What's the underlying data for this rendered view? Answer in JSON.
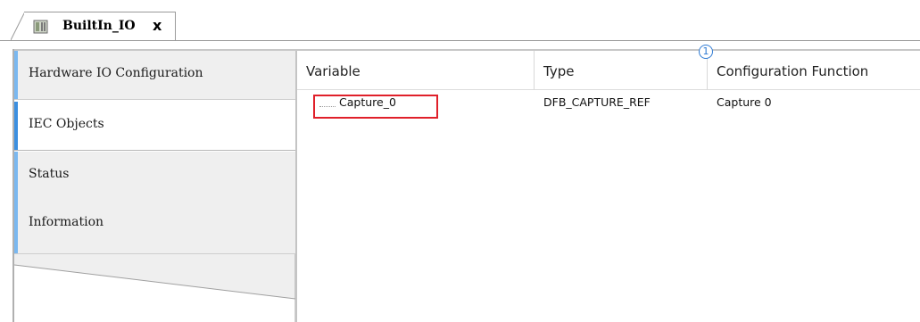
{
  "tab": {
    "title": "BuiltIn_IO",
    "close_glyph": "x",
    "icon": "device-icon"
  },
  "sidebar": {
    "items": [
      {
        "label": "Hardware IO Configuration",
        "active": false
      },
      {
        "label": "IEC Objects",
        "active": true
      },
      {
        "label": "Status",
        "active": false
      },
      {
        "label": "Information",
        "active": false
      }
    ]
  },
  "table": {
    "columns": [
      "Variable",
      "Type",
      "Configuration Function"
    ],
    "rows": [
      {
        "variable": "Capture_0",
        "type": "DFB_CAPTURE_REF",
        "function": "Capture 0"
      }
    ]
  },
  "marker": {
    "label": "1",
    "color": "#2f7bd4"
  },
  "colors": {
    "highlight_box": "#e0202a",
    "active_accent": "#3b8fe0",
    "inactive_accent": "#7ab8f0"
  }
}
